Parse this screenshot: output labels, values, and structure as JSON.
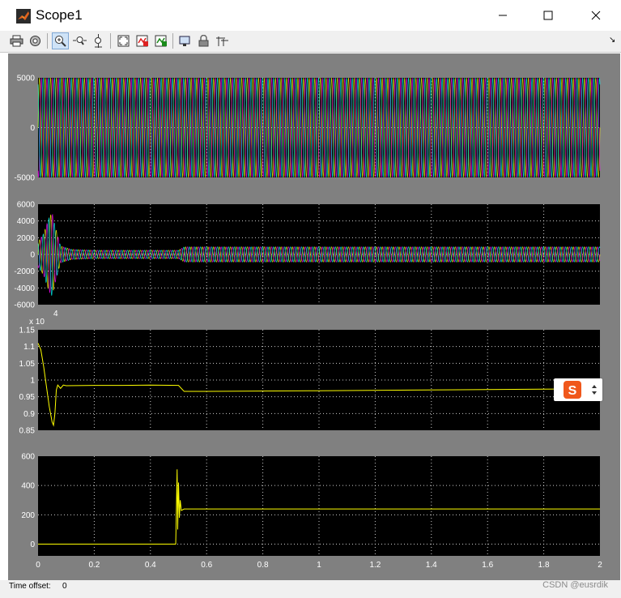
{
  "window": {
    "title": "Scope1",
    "icon": "matlab-icon",
    "controls": [
      "minimize-icon",
      "maximize-icon",
      "close-icon"
    ]
  },
  "toolbar": {
    "tools": [
      "print-icon",
      "parameters-icon",
      "zoom-icon",
      "zoom-x-icon",
      "zoom-y-icon",
      "autoscale-icon",
      "save-axes-icon",
      "restore-axes-icon",
      "floating-scope-icon",
      "lock-icon",
      "signal-selection-icon"
    ],
    "corner_glyph": "↘"
  },
  "status": {
    "time_offset_label": "Time offset:",
    "time_offset_value": "0",
    "watermark": "CSDN @eusrdik"
  },
  "colors": {
    "plot_background": "#000000",
    "figure_background": "#808080",
    "grid": "#ffffff",
    "trace_yellow": "#ffff00"
  },
  "chart_data": [
    {
      "type": "line",
      "ylim": [
        -5000,
        5000
      ],
      "yticks": [
        "5000",
        "0",
        "-5000"
      ],
      "xlim": [
        0,
        2
      ],
      "grid": true,
      "description_values": {
        "amplitude": 5000,
        "series_count": 3,
        "frequency_hz": 50
      },
      "series_colors": [
        "#ffff00",
        "#ff00ff",
        "#00ffff"
      ]
    },
    {
      "type": "line",
      "ylim": [
        -6000,
        6000
      ],
      "yticks": [
        "6000",
        "4000",
        "2000",
        "0",
        "-2000",
        "-4000",
        "-6000"
      ],
      "xlim": [
        0,
        2
      ],
      "grid": true,
      "x": [
        0,
        0.02,
        0.04,
        0.05,
        0.06,
        0.08,
        0.12,
        0.2,
        0.5,
        0.52,
        1.0,
        2.0
      ],
      "envelope": [
        1500,
        2500,
        4500,
        5000,
        3500,
        1000,
        600,
        500,
        500,
        900,
        900,
        900
      ],
      "series_colors": [
        "#ffff00",
        "#ff00ff",
        "#00ffff"
      ]
    },
    {
      "type": "line",
      "ylim": [
        0.85,
        1.15
      ],
      "yticks": [
        "1.15",
        "1.1",
        "1.05",
        "1",
        "0.95",
        "0.9",
        "0.85"
      ],
      "exponent_base": "x 10",
      "exponent_power": "4",
      "xlim": [
        0,
        2
      ],
      "grid": true,
      "series": [
        {
          "color": "#ffff00",
          "x": [
            0,
            0.01,
            0.02,
            0.03,
            0.04,
            0.05,
            0.055,
            0.06,
            0.065,
            0.07,
            0.08,
            0.09,
            0.1,
            0.2,
            0.3,
            0.4,
            0.5,
            0.52,
            0.6,
            1.0,
            1.5,
            2.0
          ],
          "y": [
            1.11,
            1.09,
            1.04,
            0.98,
            0.92,
            0.875,
            0.865,
            0.9,
            0.97,
            0.985,
            0.975,
            0.985,
            0.983,
            0.984,
            0.984,
            0.985,
            0.984,
            0.966,
            0.966,
            0.968,
            0.971,
            0.974
          ]
        }
      ]
    },
    {
      "type": "line",
      "ylim": [
        -80,
        600
      ],
      "yticks": [
        "600",
        "400",
        "200",
        "0"
      ],
      "xlim": [
        0,
        2
      ],
      "xticks": [
        "0",
        "0.2",
        "0.4",
        "0.6",
        "0.8",
        "1",
        "1.2",
        "1.4",
        "1.6",
        "1.8",
        "2"
      ],
      "grid": true,
      "series": [
        {
          "color": "#ffff00",
          "x": [
            0,
            0.49,
            0.495,
            0.497,
            0.5,
            0.503,
            0.506,
            0.51,
            0.52,
            2.0
          ],
          "y": [
            0,
            0,
            510,
            100,
            420,
            180,
            300,
            230,
            240,
            240
          ]
        }
      ]
    }
  ]
}
